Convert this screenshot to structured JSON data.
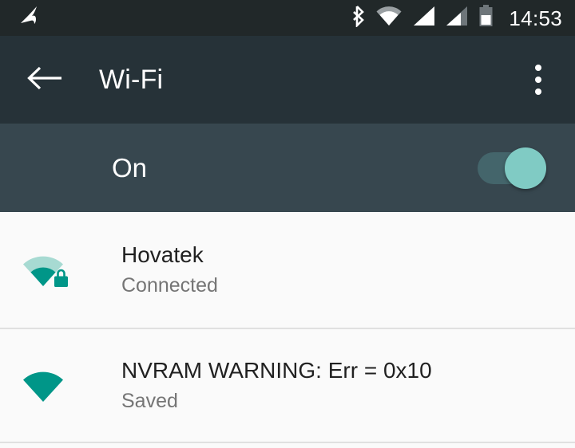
{
  "status_bar": {
    "notification_icon": "app-notification-icon",
    "icons": [
      "bluetooth-icon",
      "wifi-signal-icon",
      "cellular-signal-1-icon",
      "cellular-signal-2-icon",
      "battery-icon"
    ],
    "time": "14:53",
    "background_color": "#212829",
    "icon_color": "#FFFFFF"
  },
  "app_bar": {
    "back_icon": "back-arrow-icon",
    "title": "Wi-Fi",
    "overflow_icon": "overflow-menu-icon",
    "background_color": "#263238",
    "text_color": "#FFFFFF"
  },
  "wifi_toggle": {
    "label": "On",
    "state": "on",
    "background_color": "#37474F",
    "thumb_color": "#80CBC4",
    "track_color": "#44656B"
  },
  "networks": [
    {
      "ssid": "Hovatek",
      "status": "Connected",
      "icon": "wifi-signal-locked-icon",
      "signal_bars": 2,
      "secured": true,
      "icon_color": "#009688",
      "icon_dim_color": "#A7DAD2"
    },
    {
      "ssid": "NVRAM WARNING: Err = 0x10",
      "status": "Saved",
      "icon": "wifi-signal-icon",
      "signal_bars": 4,
      "secured": false,
      "icon_color": "#009688",
      "icon_dim_color": "#009688"
    }
  ],
  "colors": {
    "list_background": "#FAFAFA",
    "divider": "#E0E0E0",
    "title_text": "#212121",
    "subtitle_text": "#757575",
    "accent": "#009688"
  }
}
